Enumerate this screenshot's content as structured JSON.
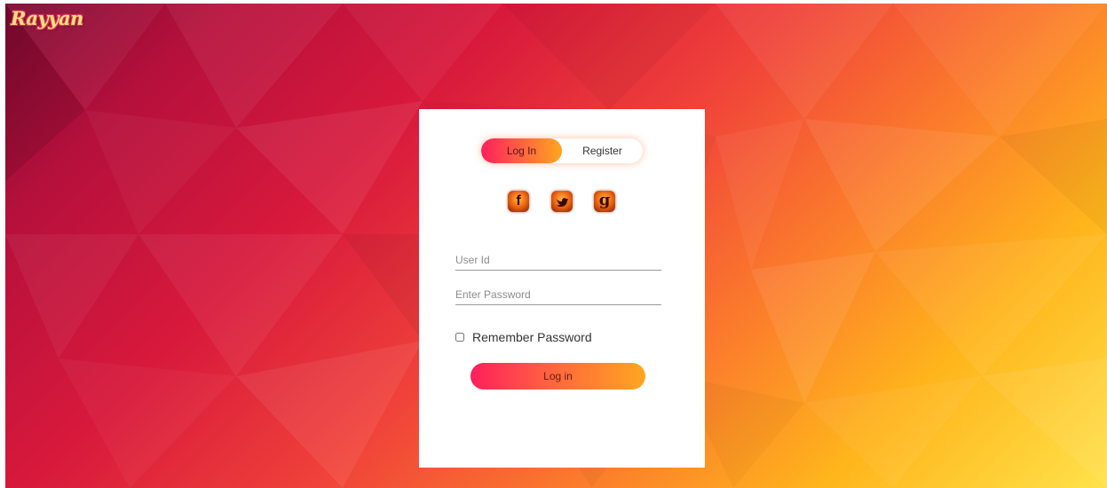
{
  "app": {
    "logo_text": "Rayyan"
  },
  "tabs": {
    "login_label": "Log In",
    "register_label": "Register"
  },
  "social": {
    "facebook_glyph": "f",
    "twitter_icon": "twitter-bird-icon",
    "google_glyph": "g"
  },
  "form": {
    "userid_placeholder": "User Id",
    "userid_value": "",
    "password_placeholder": "Enter Password",
    "password_value": "",
    "remember_label": "Remember Password",
    "remember_checked": false,
    "submit_label": "Log in"
  },
  "colors": {
    "accent_start": "#ff1f5c",
    "accent_end": "#ffa61f",
    "background_dark": "#7d0a32",
    "background_light": "#ffe24a"
  }
}
